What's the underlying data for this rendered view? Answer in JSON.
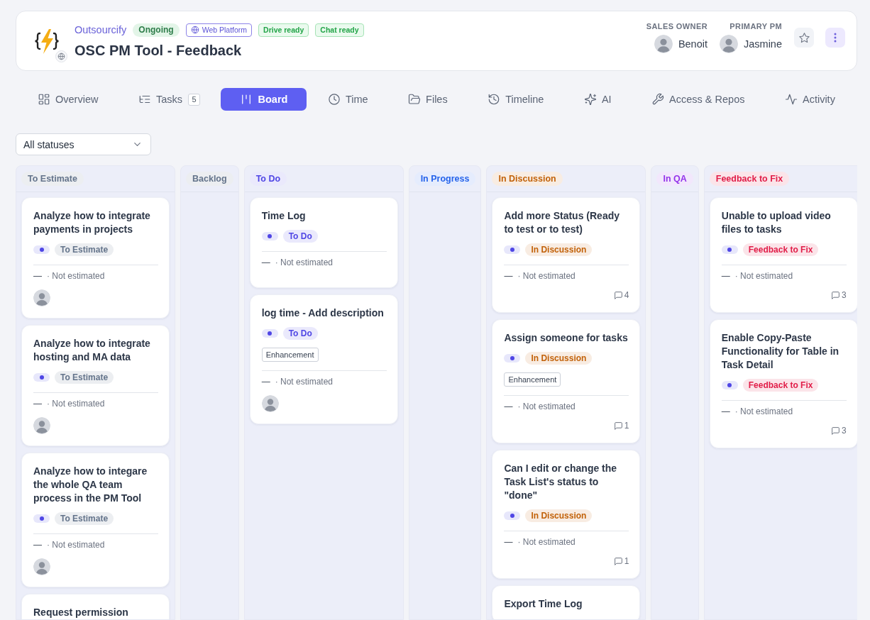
{
  "project": {
    "client": "Outsourcify",
    "status": "Ongoing",
    "tags": [
      {
        "label": "Web Platform",
        "kind": "platform"
      },
      {
        "label": "Drive ready",
        "kind": "ready"
      },
      {
        "label": "Chat ready",
        "kind": "ready"
      }
    ],
    "title": "OSC PM Tool - Feedback"
  },
  "people": [
    {
      "role": "SALES OWNER",
      "name": "Benoit"
    },
    {
      "role": "PRIMARY PM",
      "name": "Jasmine"
    }
  ],
  "tabs": [
    {
      "label": "Overview",
      "selected": false
    },
    {
      "label": "Tasks",
      "count": "5",
      "selected": false
    },
    {
      "label": "Board",
      "selected": true
    },
    {
      "label": "Time",
      "selected": false
    },
    {
      "label": "Files",
      "selected": false
    },
    {
      "label": "Timeline",
      "selected": false
    },
    {
      "label": "AI",
      "selected": false
    },
    {
      "label": "Access & Repos",
      "selected": false
    },
    {
      "label": "Activity",
      "selected": false
    }
  ],
  "filter": {
    "value": "All statuses"
  },
  "columns": [
    {
      "title": "To Estimate",
      "color": "#64748b",
      "cards": [
        {
          "title": "Analyze how to integrate payments in projects",
          "status": "To Estimate",
          "time_logged": "—",
          "estimate": "· Not estimated",
          "assigned": true
        },
        {
          "title": "Analyze how to integrate hosting and MA data",
          "status": "To Estimate",
          "time_logged": "—",
          "estimate": "· Not estimated",
          "assigned": true
        },
        {
          "title": "Analyze how to integare the whole QA team process in the PM Tool",
          "status": "To Estimate",
          "time_logged": "—",
          "estimate": "· Not estimated",
          "assigned": true
        },
        {
          "title": "Request permission"
        }
      ]
    },
    {
      "title": "Backlog",
      "color": "#64748b"
    },
    {
      "title": "To Do",
      "color": "#4f46e5",
      "cards": [
        {
          "title": "Time Log",
          "status": "To Do",
          "time_logged": "—",
          "estimate": "· Not estimated",
          "assigned": false
        },
        {
          "title": "log time - Add description",
          "status": "To Do",
          "tags": [
            "Enhancement"
          ],
          "time_logged": "—",
          "estimate": "· Not estimated",
          "assigned": true
        }
      ]
    },
    {
      "title": "In Progress",
      "color": "#2563eb"
    },
    {
      "title": "In Discussion",
      "color": "#c2620a",
      "cards": [
        {
          "title": "Add more Status (Ready to test or to test)",
          "status": "In Discussion",
          "time_logged": "—",
          "estimate": "· Not estimated",
          "assigned": false,
          "comments": "4"
        },
        {
          "title": "Assign someone for tasks",
          "status": "In Discussion",
          "tags": [
            "Enhancement"
          ],
          "time_logged": "—",
          "estimate": "· Not estimated",
          "assigned": false,
          "comments": "1"
        },
        {
          "title": "Can I edit or change the Task List's status to \"done\"",
          "status": "In Discussion",
          "time_logged": "—",
          "estimate": "· Not estimated",
          "assigned": false,
          "comments": "1"
        },
        {
          "title": "Export Time Log"
        }
      ]
    },
    {
      "title": "In QA",
      "color": "#9333ea"
    },
    {
      "title": "Feedback to Fix",
      "color": "#e11d48",
      "cards": [
        {
          "title": "Unable to upload video files to tasks",
          "status": "Feedback to Fix",
          "time_logged": "—",
          "estimate": "· Not estimated",
          "assigned": false,
          "comments": "3"
        },
        {
          "title": "Enable Copy-Paste Functionality for Table in Task Detail",
          "status": "Feedback to Fix",
          "time_logged": "—",
          "estimate": "· Not estimated",
          "assigned": false,
          "comments": "3"
        }
      ]
    }
  ]
}
